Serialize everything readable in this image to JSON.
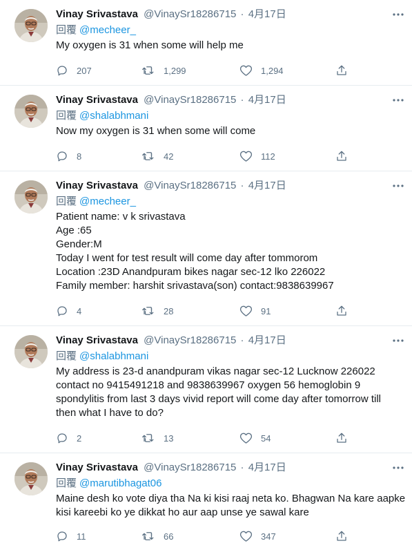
{
  "tweets": [
    {
      "name": "Vinay Srivastava",
      "handle": "@VinaySr18286715",
      "separator": "·",
      "time": "4月17日",
      "reply_label": "回覆",
      "reply_to": "@mecheer_",
      "lines": [
        "My oxygen is 31 when some will help me"
      ],
      "replies": "207",
      "retweets": "1,299",
      "likes": "1,294"
    },
    {
      "name": "Vinay Srivastava",
      "handle": "@VinaySr18286715",
      "separator": "·",
      "time": "4月17日",
      "reply_label": "回覆",
      "reply_to": "@shalabhmani",
      "lines": [
        "Now my oxygen is 31 when some will come"
      ],
      "replies": "8",
      "retweets": "42",
      "likes": "112"
    },
    {
      "name": "Vinay Srivastava",
      "handle": "@VinaySr18286715",
      "separator": "·",
      "time": "4月17日",
      "reply_label": "回覆",
      "reply_to": "@mecheer_",
      "lines": [
        "Patient name: v k srivastava",
        "Age :65",
        "Gender:M",
        "Today I went for test result will come day after tommorom",
        "Location :23D Anandpuram bikes nagar sec-12 lko 226022",
        "Family member: harshit srivastava(son) contact:9838639967"
      ],
      "replies": "4",
      "retweets": "28",
      "likes": "91"
    },
    {
      "name": "Vinay Srivastava",
      "handle": "@VinaySr18286715",
      "separator": "·",
      "time": "4月17日",
      "reply_label": "回覆",
      "reply_to": "@shalabhmani",
      "lines": [
        "My address is 23-d anandpuram vikas nagar sec-12 Lucknow 226022",
        "contact no 9415491218 and 9838639967 oxygen 56 hemoglobin 9",
        "spondylitis  from last 3 days vivid report will come day after tomorrow till",
        "then what I have to do?"
      ],
      "replies": "2",
      "retweets": "13",
      "likes": "54"
    },
    {
      "name": "Vinay Srivastava",
      "handle": "@VinaySr18286715",
      "separator": "·",
      "time": "4月17日",
      "reply_label": "回覆",
      "reply_to": "@marutibhagat06",
      "lines": [
        "Maine desh ko vote diya tha Na ki kisi raaj neta ko. Bhagwan Na kare aapke",
        "kisi kareebi ko ye dikkat ho aur aap unse ye sawal kare"
      ],
      "replies": "11",
      "retweets": "66",
      "likes": "347"
    }
  ],
  "icons": {
    "more": "more-icon",
    "reply": "reply-icon",
    "retweet": "retweet-icon",
    "like": "like-icon",
    "share": "share-icon"
  },
  "colors": {
    "text": "#14171a",
    "secondary": "#5b7083",
    "mention": "#1b95e0",
    "divider": "#e6ecf0"
  }
}
